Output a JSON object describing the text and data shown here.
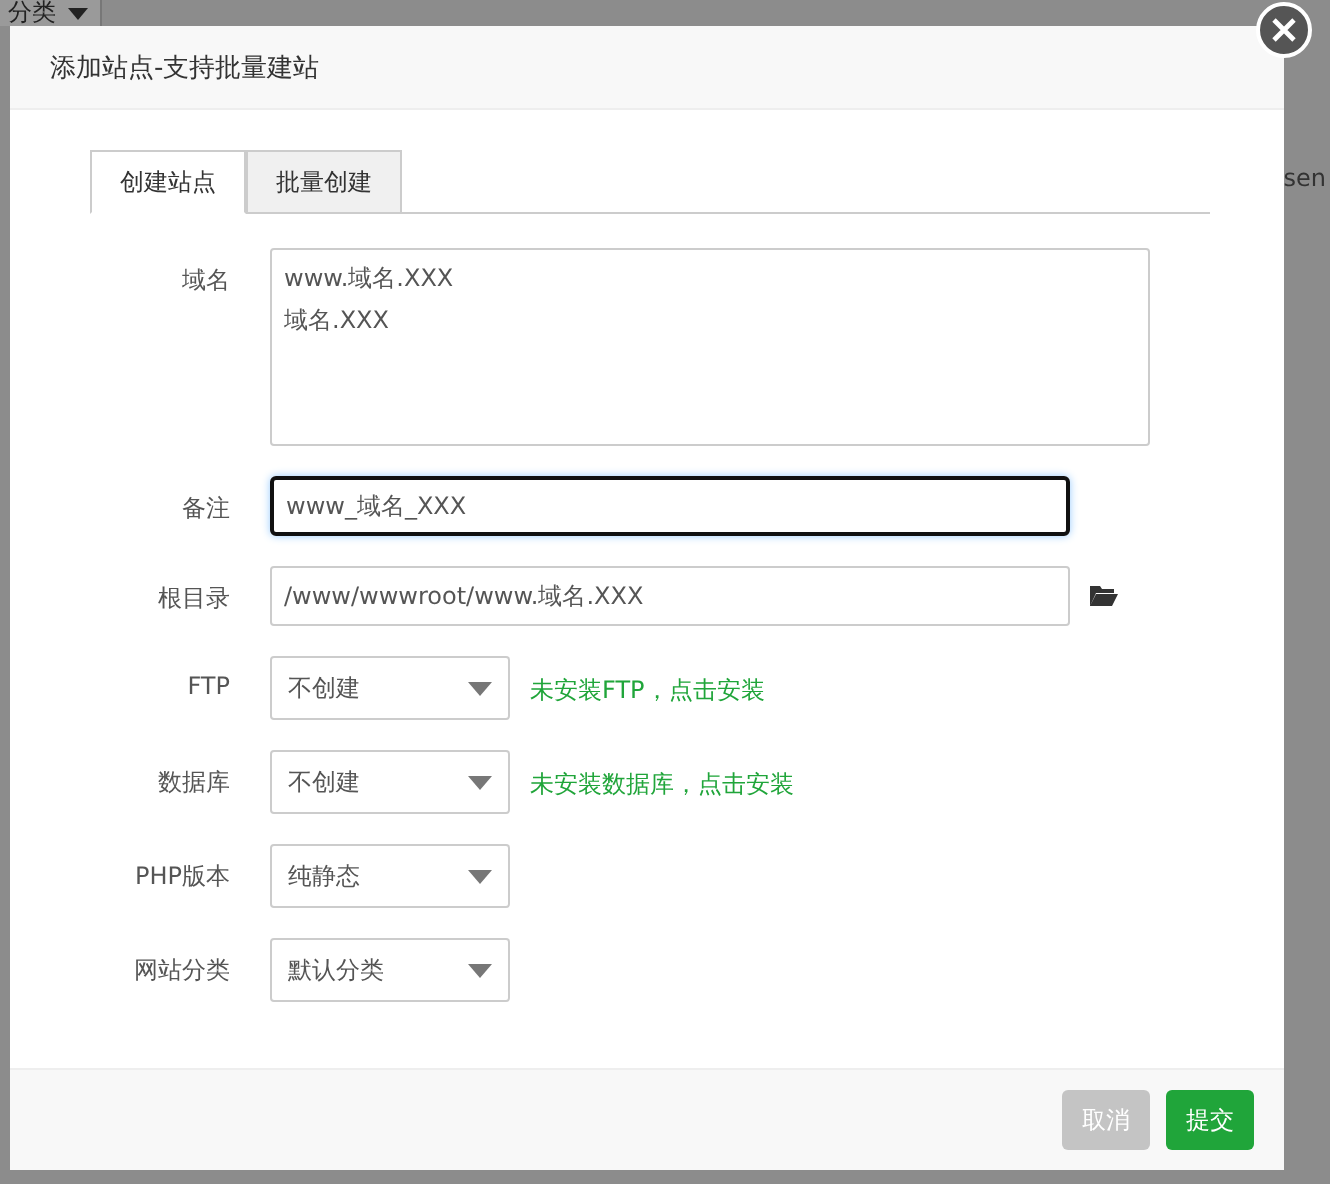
{
  "background": {
    "filter_select": "分类",
    "cell_text": "sen"
  },
  "dialog": {
    "title": "添加站点-支持批量建站",
    "tabs": [
      {
        "label": "创建站点",
        "selected": true
      },
      {
        "label": "批量创建",
        "selected": false
      }
    ],
    "fields": [
      {
        "kind": "textarea",
        "label": "域名",
        "lines": [
          "www.域名.XXX",
          "域名.XXX"
        ]
      },
      {
        "kind": "input",
        "label": "备注",
        "value": "www_域名_XXX",
        "focused": true
      },
      {
        "kind": "path",
        "label": "根目录",
        "value": "/www/wwwroot/www.域名.XXX"
      },
      {
        "kind": "select",
        "label": "FTP",
        "value": "不创建",
        "hint": "未安装FTP，点击安装"
      },
      {
        "kind": "select",
        "label": "数据库",
        "value": "不创建",
        "hint": "未安装数据库，点击安装"
      },
      {
        "kind": "select",
        "label": "PHP版本",
        "value": "纯静态"
      },
      {
        "kind": "select",
        "label": "网站分类",
        "value": "默认分类"
      }
    ],
    "buttons": [
      {
        "label": "取消",
        "kind": "secondary"
      },
      {
        "label": "提交",
        "kind": "primary"
      }
    ]
  }
}
